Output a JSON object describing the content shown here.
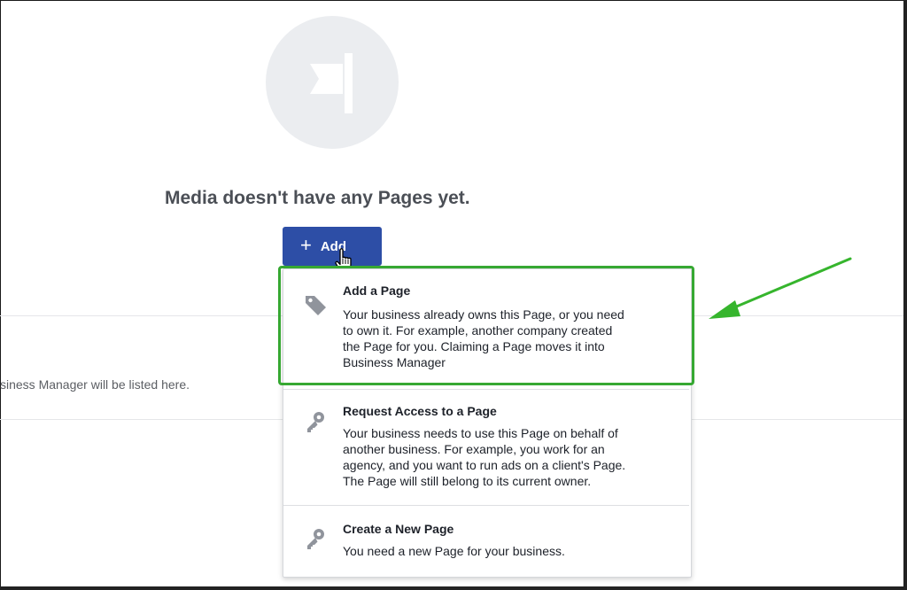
{
  "empty_state": {
    "icon": "flag-icon",
    "title": "Media doesn't have any Pages yet."
  },
  "add_button": {
    "icon": "plus-icon",
    "label": "Add"
  },
  "background": {
    "hint_text": "siness Manager will be listed here."
  },
  "add_menu": {
    "items": [
      {
        "icon": "tag-icon",
        "title": "Add a Page",
        "lines": [
          "Your business already owns this Page, or you need",
          "to own it. For example, another company created",
          "the Page for you. Claiming a Page moves it into",
          "Business Manager"
        ]
      },
      {
        "icon": "key-icon",
        "title": "Request Access to a Page",
        "lines": [
          "Your business needs to use this Page on behalf of",
          "another business. For example, you work for an",
          "agency, and you want to run ads on a client's Page.",
          "The Page will still belong to its current owner."
        ]
      },
      {
        "icon": "key-icon",
        "title": "Create a New Page",
        "lines": [
          "You need a new Page for your business."
        ]
      }
    ]
  },
  "colors": {
    "primary_button": "#2d4ea6",
    "highlight": "#36a832",
    "icon_grey": "#90949c"
  }
}
